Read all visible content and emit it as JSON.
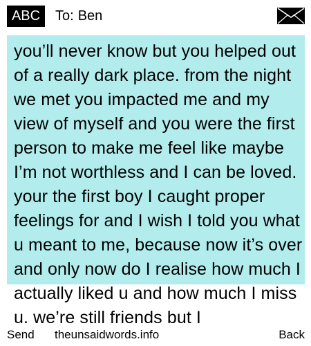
{
  "header": {
    "input_mode": "ABC",
    "to_label": "To:",
    "recipient": "Ben",
    "envelope_icon": "envelope-icon"
  },
  "message": {
    "text": "you’ll never know but you helped out of a really dark place. from the night we met you impacted me and my view of myself and you were the first person to make me feel like maybe I’m not worthless and I can be loved. your the first boy I caught proper feelings for and I wish I told you what u meant to me, because now it’s over and only now do I realise how much I actually liked u and how much I miss u. we’re still friends but I",
    "highlight_color": "#b2ecec"
  },
  "softkeys": {
    "left": "Send",
    "center": "theunsaidwords.info",
    "right": "Back"
  }
}
